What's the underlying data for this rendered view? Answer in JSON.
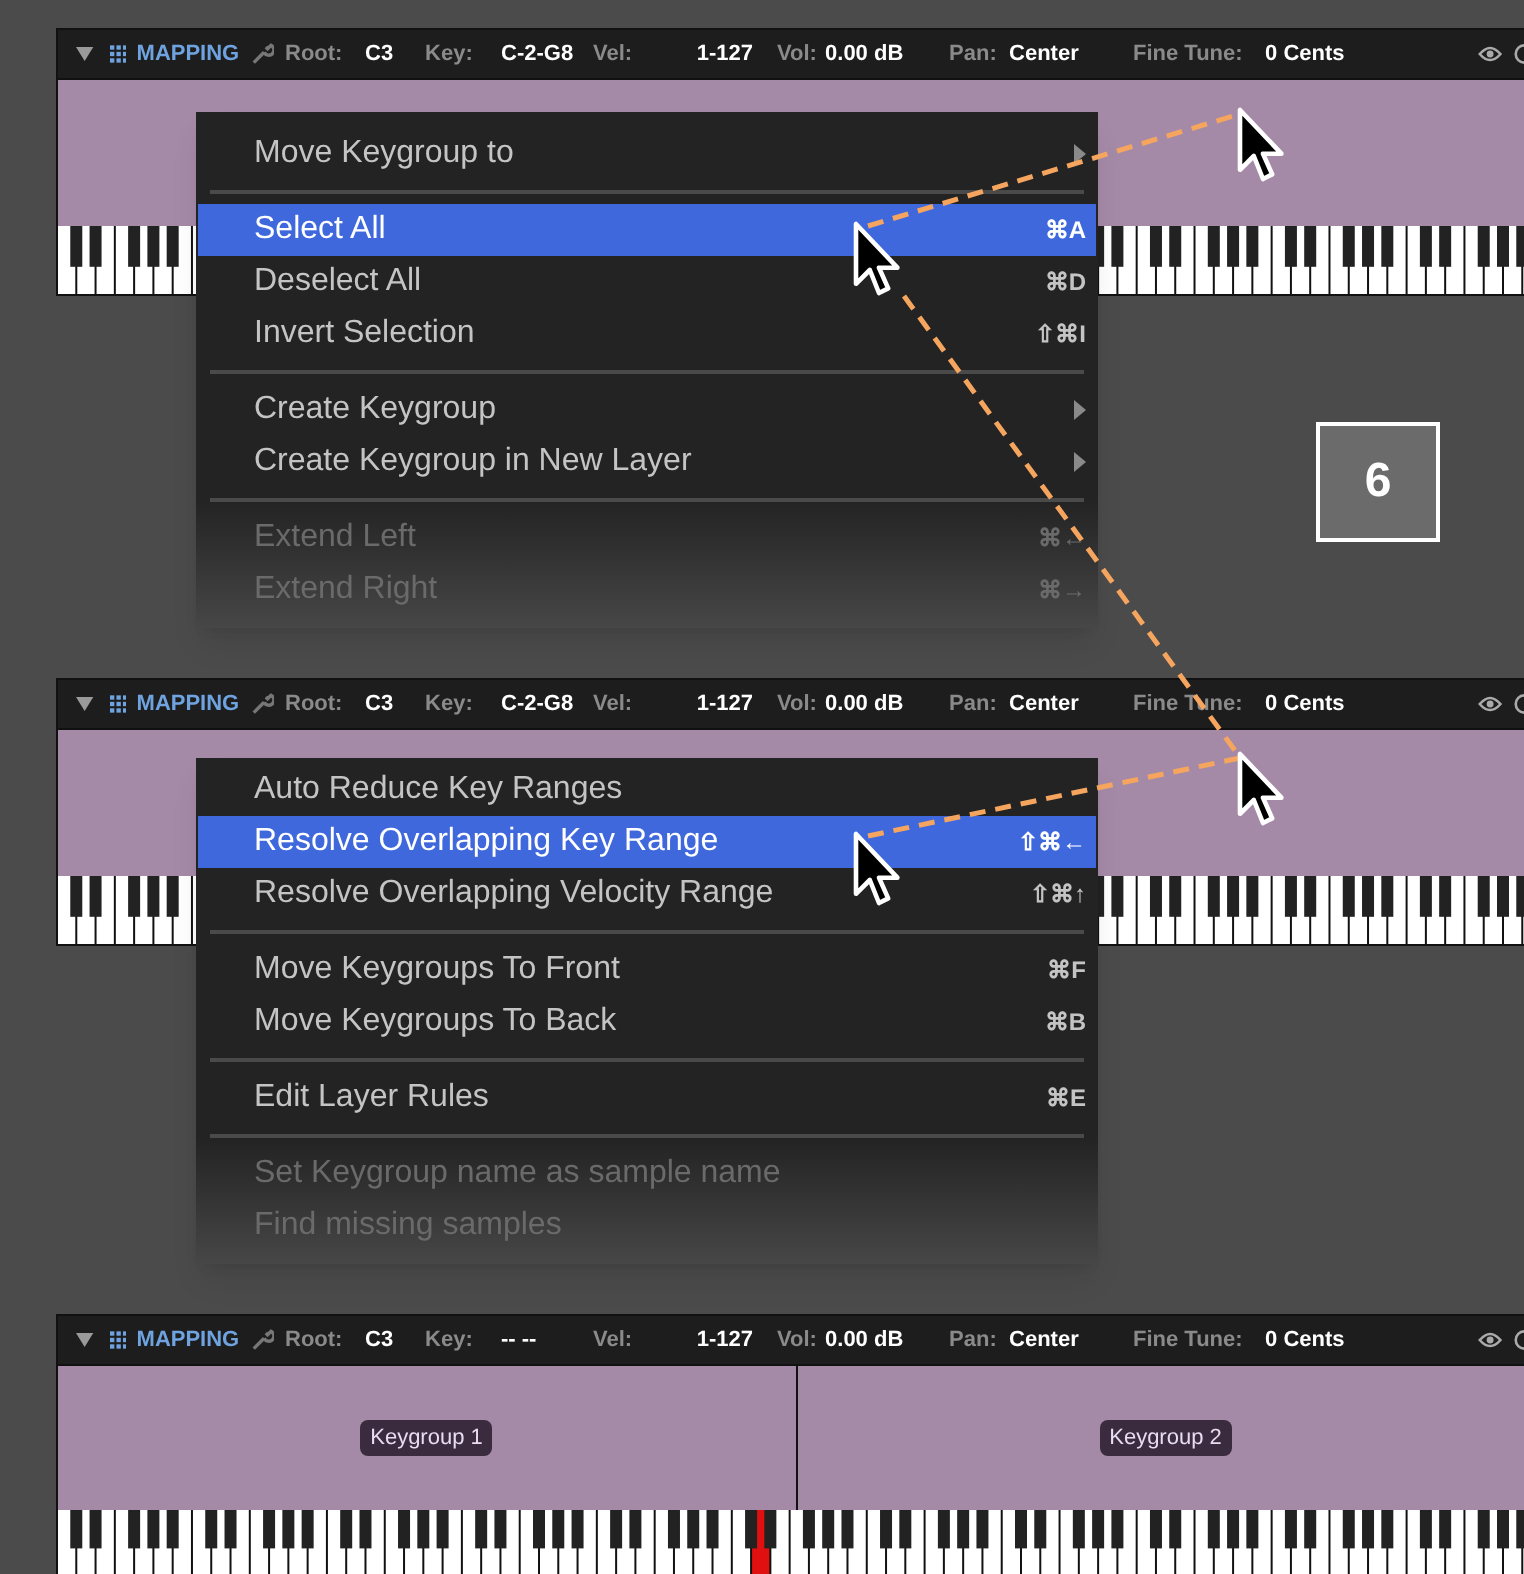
{
  "panels": [
    {
      "header": {
        "title": "MAPPING",
        "fields": [
          {
            "label": "Root:",
            "value": "C3"
          },
          {
            "label": "Key:",
            "value": "C-2-G8"
          },
          {
            "label": "Vel:",
            "value": "1-127"
          },
          {
            "label": "Vol:",
            "value": "0.00 dB"
          },
          {
            "label": "Pan:",
            "value": "Center"
          },
          {
            "label": "Fine Tune:",
            "value": "0 Cents"
          }
        ]
      },
      "pressed_key_visible": false,
      "menu": {
        "items": [
          {
            "kind": "item",
            "label": "Move Keygroup to",
            "submenu": true,
            "selected": false,
            "disabled": false
          },
          {
            "kind": "separator"
          },
          {
            "kind": "item",
            "label": "Select All",
            "shortcut": "⌘A",
            "selected": true,
            "disabled": false
          },
          {
            "kind": "item",
            "label": "Deselect All",
            "shortcut": "⌘D",
            "selected": false,
            "disabled": false
          },
          {
            "kind": "item",
            "label": "Invert Selection",
            "shortcut": "⇧⌘I",
            "selected": false,
            "disabled": false
          },
          {
            "kind": "separator"
          },
          {
            "kind": "item",
            "label": "Create Keygroup",
            "submenu": true,
            "selected": false,
            "disabled": false
          },
          {
            "kind": "item",
            "label": "Create Keygroup in New Layer",
            "submenu": true,
            "selected": false,
            "disabled": false
          },
          {
            "kind": "separator"
          },
          {
            "kind": "item",
            "label": "Extend Left",
            "shortcut": "⌘←",
            "selected": false,
            "disabled": true
          },
          {
            "kind": "item",
            "label": "Extend Right",
            "shortcut": "⌘→",
            "selected": false,
            "disabled": true
          }
        ]
      }
    },
    {
      "header": {
        "title": "MAPPING",
        "fields": [
          {
            "label": "Root:",
            "value": "C3"
          },
          {
            "label": "Key:",
            "value": "C-2-G8"
          },
          {
            "label": "Vel:",
            "value": "1-127"
          },
          {
            "label": "Vol:",
            "value": "0.00 dB"
          },
          {
            "label": "Pan:",
            "value": "Center"
          },
          {
            "label": "Fine Tune:",
            "value": "0 Cents"
          }
        ]
      },
      "pressed_key_visible": false,
      "menu": {
        "items": [
          {
            "kind": "item",
            "label": "Auto Reduce Key Ranges",
            "selected": false,
            "disabled": false
          },
          {
            "kind": "item",
            "label": "Resolve Overlapping Key Range",
            "shortcut": "⇧⌘←",
            "selected": true,
            "disabled": false
          },
          {
            "kind": "item",
            "label": "Resolve Overlapping Velocity Range",
            "shortcut": "⇧⌘↑",
            "selected": false,
            "disabled": false
          },
          {
            "kind": "separator"
          },
          {
            "kind": "item",
            "label": "Move Keygroups To Front",
            "shortcut": "⌘F",
            "selected": false,
            "disabled": false
          },
          {
            "kind": "item",
            "label": "Move Keygroups To Back",
            "shortcut": "⌘B",
            "selected": false,
            "disabled": false
          },
          {
            "kind": "separator"
          },
          {
            "kind": "item",
            "label": "Edit Layer Rules",
            "shortcut": "⌘E",
            "selected": false,
            "disabled": false
          },
          {
            "kind": "separator"
          },
          {
            "kind": "item",
            "label": "Set Keygroup name as sample name",
            "selected": false,
            "disabled": true
          },
          {
            "kind": "item",
            "label": "Find missing samples",
            "selected": false,
            "disabled": true
          }
        ]
      }
    },
    {
      "header": {
        "title": "MAPPING",
        "fields": [
          {
            "label": "Root:",
            "value": "C3"
          },
          {
            "label": "Key:",
            "value": "-- --"
          },
          {
            "label": "Vel:",
            "value": "1-127"
          },
          {
            "label": "Vol:",
            "value": "0.00 dB"
          },
          {
            "label": "Pan:",
            "value": "Center"
          },
          {
            "label": "Fine Tune:",
            "value": "0 Cents"
          }
        ]
      },
      "pressed_key_visible": true,
      "keygroups": [
        {
          "label": "Keygroup 1"
        },
        {
          "label": "Keygroup 2"
        }
      ]
    }
  ],
  "step_badge": "6"
}
